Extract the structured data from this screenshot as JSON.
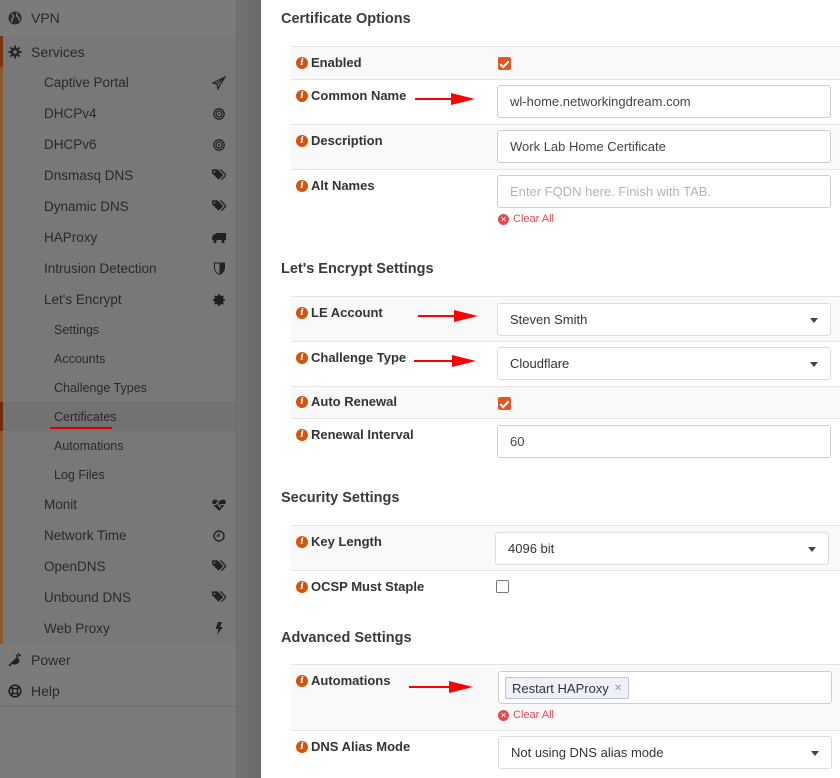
{
  "sidebar": {
    "top_items": [
      {
        "label": "VPN",
        "icon": "globe-icon"
      },
      {
        "label": "Services",
        "icon": "gear-icon"
      }
    ],
    "services_items": [
      {
        "label": "Captive Portal",
        "icon": "paper-plane-icon"
      },
      {
        "label": "DHCPv4",
        "icon": "bullseye-icon"
      },
      {
        "label": "DHCPv6",
        "icon": "bullseye-icon"
      },
      {
        "label": "Dnsmasq DNS",
        "icon": "tags-icon"
      },
      {
        "label": "Dynamic DNS",
        "icon": "tags-icon"
      },
      {
        "label": "HAProxy",
        "icon": "truck-icon"
      },
      {
        "label": "Intrusion Detection",
        "icon": "shield-icon"
      },
      {
        "label": "Let's Encrypt",
        "icon": "certificate-icon"
      }
    ],
    "lets_encrypt_items": [
      {
        "label": "Settings"
      },
      {
        "label": "Accounts"
      },
      {
        "label": "Challenge Types"
      },
      {
        "label": "Certificates",
        "active": true
      },
      {
        "label": "Automations"
      },
      {
        "label": "Log Files"
      }
    ],
    "more_services_items": [
      {
        "label": "Monit",
        "icon": "heartbeat-icon"
      },
      {
        "label": "Network Time",
        "icon": "clock-icon"
      },
      {
        "label": "OpenDNS",
        "icon": "tags-icon"
      },
      {
        "label": "Unbound DNS",
        "icon": "tags-icon"
      },
      {
        "label": "Web Proxy",
        "icon": "bolt-icon"
      }
    ],
    "bottom_items": [
      {
        "label": "Power",
        "icon": "plug-icon"
      },
      {
        "label": "Help",
        "icon": "life-ring-icon"
      }
    ]
  },
  "modal": {
    "certificate_options": {
      "title": "Certificate Options",
      "enabled": {
        "label": "Enabled",
        "checked": true
      },
      "common_name": {
        "label": "Common Name",
        "value": "wl-home.networkingdream.com"
      },
      "description": {
        "label": "Description",
        "value": "Work Lab Home Certificate"
      },
      "alt_names": {
        "label": "Alt Names",
        "placeholder": "Enter FQDN here. Finish with TAB.",
        "clear_all": "Clear All"
      }
    },
    "le_settings": {
      "title": "Let's Encrypt Settings",
      "le_account": {
        "label": "LE Account",
        "value": "Steven Smith"
      },
      "challenge_type": {
        "label": "Challenge Type",
        "value": "Cloudflare"
      },
      "auto_renewal": {
        "label": "Auto Renewal",
        "checked": true
      },
      "renewal_interval": {
        "label": "Renewal Interval",
        "value": "60"
      }
    },
    "security_settings": {
      "title": "Security Settings",
      "key_length": {
        "label": "Key Length",
        "value": "4096 bit"
      },
      "ocsp": {
        "label": "OCSP Must Staple",
        "checked": false
      }
    },
    "advanced_settings": {
      "title": "Advanced Settings",
      "automations": {
        "label": "Automations",
        "tags": [
          "Restart HAProxy"
        ],
        "clear_all": "Clear All"
      },
      "dns_alias_mode": {
        "label": "DNS Alias Mode",
        "value": "Not using DNS alias mode"
      }
    }
  },
  "colors": {
    "accent": "#e5551f",
    "info_icon": "#d2550e",
    "clear_all": "#e04b4b",
    "annotation_arrow": "#ff0000"
  }
}
